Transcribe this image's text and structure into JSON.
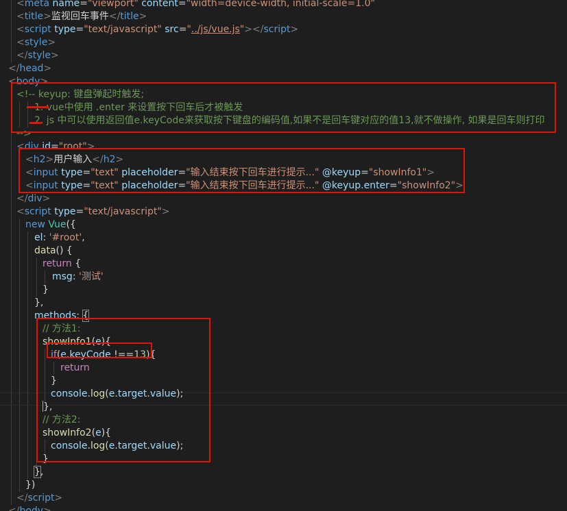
{
  "editor": {
    "language": "html",
    "colors": {
      "background": "#1e1e1e",
      "annotation": "#e51400"
    },
    "lines": [
      [
        [
          "tk-p",
          "<"
        ],
        [
          "tk-tag",
          "meta"
        ],
        [
          "tk-text",
          " "
        ],
        [
          "tk-attr",
          "name"
        ],
        [
          "tk-text",
          "="
        ],
        [
          "tk-str",
          "\"viewport\""
        ],
        [
          "tk-text",
          " "
        ],
        [
          "tk-attr",
          "content"
        ],
        [
          "tk-text",
          "="
        ],
        [
          "tk-str",
          "\"width=device-width, initial-scale=1.0\""
        ]
      ],
      [
        [
          "tk-p",
          "<"
        ],
        [
          "tk-tag",
          "title"
        ],
        [
          "tk-p",
          ">"
        ],
        [
          "tk-text",
          "监视回车事件"
        ],
        [
          "tk-p",
          "</"
        ],
        [
          "tk-tag",
          "title"
        ],
        [
          "tk-p",
          ">"
        ]
      ],
      [
        [
          "tk-p",
          "<"
        ],
        [
          "tk-tag",
          "script"
        ],
        [
          "tk-text",
          " "
        ],
        [
          "tk-attr",
          "type"
        ],
        [
          "tk-text",
          "="
        ],
        [
          "tk-str",
          "\"text/javascript\""
        ],
        [
          "tk-text",
          " "
        ],
        [
          "tk-attr",
          "src"
        ],
        [
          "tk-text",
          "="
        ],
        [
          "tk-str",
          "\""
        ],
        [
          "tk-str tk-u",
          "../js/vue.js"
        ],
        [
          "tk-str",
          "\""
        ],
        [
          "tk-p",
          "></"
        ],
        [
          "tk-tag",
          "script"
        ],
        [
          "tk-p",
          ">"
        ]
      ],
      [
        [
          "tk-p",
          "<"
        ],
        [
          "tk-tag",
          "style"
        ],
        [
          "tk-p",
          ">"
        ]
      ],
      [
        [
          "tk-p",
          "</"
        ],
        [
          "tk-tag",
          "style"
        ],
        [
          "tk-p",
          ">"
        ]
      ],
      [
        [
          "tk-p",
          "</"
        ],
        [
          "tk-tag",
          "head"
        ],
        [
          "tk-p",
          ">"
        ]
      ],
      [
        [
          "tk-p",
          "<"
        ],
        [
          "tk-tag",
          "body"
        ],
        [
          "tk-p",
          ">"
        ]
      ],
      [
        [
          "tk-com",
          "<!-- keyup: 键盘弹起时触发;"
        ]
      ],
      [
        [
          "tk-com",
          "1. vue中使用 .enter 来设置按下回车后才被触发"
        ]
      ],
      [
        [
          "tk-com",
          "2. js 中可以使用返回值e.keyCode来获取按下键盘的编码值,如果不是回车键对应的值13,就不做操作, 如果是回车则打印"
        ]
      ],
      [
        [
          "tk-com",
          "-->"
        ]
      ],
      [
        [
          "tk-p",
          "<"
        ],
        [
          "tk-tag",
          "div"
        ],
        [
          "tk-text",
          " "
        ],
        [
          "tk-attr",
          "id"
        ],
        [
          "tk-text",
          "="
        ],
        [
          "tk-str",
          "\"root\""
        ],
        [
          "tk-p",
          ">"
        ]
      ],
      [
        [
          "tk-p",
          "<"
        ],
        [
          "tk-tag",
          "h2"
        ],
        [
          "tk-p",
          ">"
        ],
        [
          "tk-text",
          "用户输入"
        ],
        [
          "tk-p",
          "</"
        ],
        [
          "tk-tag",
          "h2"
        ],
        [
          "tk-p",
          ">"
        ]
      ],
      [
        [
          "tk-p",
          "<"
        ],
        [
          "tk-tag",
          "input"
        ],
        [
          "tk-text",
          " "
        ],
        [
          "tk-attr",
          "type"
        ],
        [
          "tk-text",
          "="
        ],
        [
          "tk-str",
          "\"text\""
        ],
        [
          "tk-text",
          " "
        ],
        [
          "tk-attr",
          "placeholder"
        ],
        [
          "tk-text",
          "="
        ],
        [
          "tk-str",
          "\"输入结束按下回车进行提示...\""
        ],
        [
          "tk-text",
          " "
        ],
        [
          "tk-attr",
          "@keyup"
        ],
        [
          "tk-text",
          "="
        ],
        [
          "tk-str",
          "\"showInfo1\""
        ],
        [
          "tk-p",
          ">"
        ]
      ],
      [
        [
          "tk-p",
          "<"
        ],
        [
          "tk-tag",
          "input"
        ],
        [
          "tk-text",
          " "
        ],
        [
          "tk-attr",
          "type"
        ],
        [
          "tk-text",
          "="
        ],
        [
          "tk-str",
          "\"text\""
        ],
        [
          "tk-text",
          " "
        ],
        [
          "tk-attr",
          "placeholder"
        ],
        [
          "tk-text",
          "="
        ],
        [
          "tk-str",
          "\"输入结束按下回车进行提示...\""
        ],
        [
          "tk-text",
          " "
        ],
        [
          "tk-attr",
          "@keyup.enter"
        ],
        [
          "tk-text",
          "="
        ],
        [
          "tk-str",
          "\"showInfo2\""
        ],
        [
          "tk-p",
          ">"
        ]
      ],
      [
        [
          "tk-p",
          "</"
        ],
        [
          "tk-tag",
          "div"
        ],
        [
          "tk-p",
          ">"
        ]
      ],
      [
        [
          "tk-p",
          "<"
        ],
        [
          "tk-tag",
          "script"
        ],
        [
          "tk-text",
          " "
        ],
        [
          "tk-attr",
          "type"
        ],
        [
          "tk-text",
          "="
        ],
        [
          "tk-str",
          "\"text/javascript\""
        ],
        [
          "tk-p",
          ">"
        ]
      ],
      [
        [
          "tk-tag",
          "new"
        ],
        [
          "tk-text",
          " "
        ],
        [
          "tk-cls",
          "Vue"
        ],
        [
          "tk-text",
          "({"
        ]
      ],
      [
        [
          "tk-var",
          "el"
        ],
        [
          "tk-text",
          ": "
        ],
        [
          "tk-str",
          "'#root'"
        ],
        [
          "tk-text",
          ","
        ]
      ],
      [
        [
          "tk-func",
          "data"
        ],
        [
          "tk-text",
          "() {"
        ]
      ],
      [
        [
          "tk-kw",
          "return"
        ],
        [
          "tk-text",
          " {"
        ]
      ],
      [
        [
          "tk-var",
          "msg"
        ],
        [
          "tk-text",
          ": "
        ],
        [
          "tk-str",
          "'测试'"
        ]
      ],
      [
        [
          "tk-text",
          "}"
        ]
      ],
      [
        [
          "tk-text",
          "},"
        ]
      ],
      [
        [
          "tk-var",
          "methods"
        ],
        [
          "tk-text",
          ": "
        ],
        [
          "tk-text bracket-hl",
          "{"
        ]
      ],
      [
        [
          "tk-com",
          "// 方法1:"
        ]
      ],
      [
        [
          "tk-func",
          "showInfo1"
        ],
        [
          "tk-text",
          "("
        ],
        [
          "tk-var",
          "e"
        ],
        [
          "tk-text",
          "){"
        ]
      ],
      [
        [
          "tk-kw",
          "if"
        ],
        [
          "tk-text",
          "("
        ],
        [
          "tk-var",
          "e"
        ],
        [
          "tk-text",
          "."
        ],
        [
          "tk-var",
          "keyCode"
        ],
        [
          "tk-text",
          " !=="
        ],
        [
          "tk-num",
          "13"
        ],
        [
          "tk-text",
          "){"
        ]
      ],
      [
        [
          "tk-kw",
          "return"
        ]
      ],
      [
        [
          "tk-text",
          "}"
        ]
      ],
      [
        [
          "tk-var",
          "console"
        ],
        [
          "tk-text",
          "."
        ],
        [
          "tk-func",
          "log"
        ],
        [
          "tk-text",
          "("
        ],
        [
          "tk-var",
          "e"
        ],
        [
          "tk-text",
          "."
        ],
        [
          "tk-var",
          "target"
        ],
        [
          "tk-text",
          "."
        ],
        [
          "tk-var",
          "value"
        ],
        [
          "tk-text",
          ");"
        ]
      ],
      [
        [
          "tk-text",
          "},"
        ]
      ],
      [
        [
          "tk-com",
          "// 方法2:"
        ]
      ],
      [
        [
          "tk-func",
          "showInfo2"
        ],
        [
          "tk-text",
          "("
        ],
        [
          "tk-var",
          "e"
        ],
        [
          "tk-text",
          "){"
        ]
      ],
      [
        [
          "tk-var",
          "console"
        ],
        [
          "tk-text",
          "."
        ],
        [
          "tk-func",
          "log"
        ],
        [
          "tk-text",
          "("
        ],
        [
          "tk-var",
          "e"
        ],
        [
          "tk-text",
          "."
        ],
        [
          "tk-var",
          "target"
        ],
        [
          "tk-text",
          "."
        ],
        [
          "tk-var",
          "value"
        ],
        [
          "tk-text",
          ");"
        ]
      ],
      [
        [
          "tk-text",
          "}"
        ]
      ],
      [
        [
          "tk-text bracket-hl",
          "}"
        ],
        [
          "tk-text",
          ","
        ]
      ],
      [
        [
          "tk-text",
          "})"
        ]
      ],
      [
        [
          "tk-p",
          "</"
        ],
        [
          "tk-tag",
          "script"
        ],
        [
          "tk-p",
          ">"
        ]
      ],
      [
        [
          "tk-p",
          "</"
        ],
        [
          "tk-tag",
          "body"
        ],
        [
          "tk-p",
          ">"
        ]
      ]
    ]
  }
}
